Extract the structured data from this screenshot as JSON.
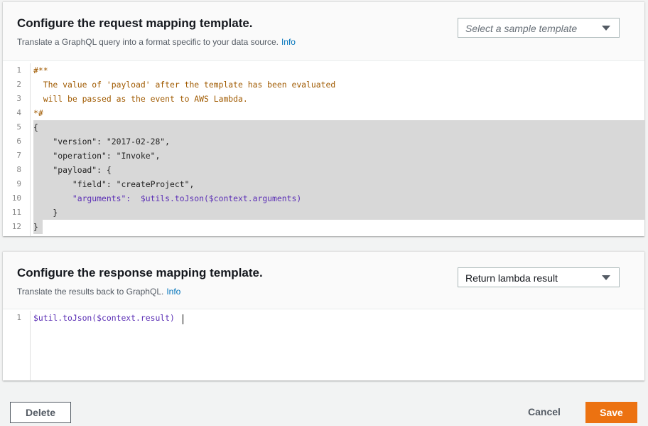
{
  "request": {
    "title": "Configure the request mapping template.",
    "subtitle": "Translate a GraphQL query into a format specific to your data source.",
    "info": "Info",
    "select_placeholder": "Select a sample template",
    "lines": [
      {
        "n": "1",
        "text": "#**"
      },
      {
        "n": "2",
        "text": "  The value of 'payload' after the template has been evaluated"
      },
      {
        "n": "3",
        "text": "  will be passed as the event to AWS Lambda."
      },
      {
        "n": "4",
        "text": "*#"
      },
      {
        "n": "5",
        "text": "{"
      },
      {
        "n": "6",
        "text": "    \"version\": \"2017-02-28\","
      },
      {
        "n": "7",
        "text": "    \"operation\": \"Invoke\","
      },
      {
        "n": "8",
        "text": "    \"payload\": {"
      },
      {
        "n": "9",
        "text": "        \"field\": \"createProject\","
      },
      {
        "n": "10",
        "text": "        \"arguments\":  $utils.toJson($context.arguments)"
      },
      {
        "n": "11",
        "text": "    }"
      },
      {
        "n": "12",
        "text": "}"
      }
    ]
  },
  "response": {
    "title": "Configure the response mapping template.",
    "subtitle": "Translate the results back to GraphQL.",
    "info": "Info",
    "select_value": "Return lambda result",
    "lines": [
      {
        "n": "1",
        "text": "$util.toJson($context.result)"
      }
    ]
  },
  "footer": {
    "delete_label": "Delete",
    "cancel_label": "Cancel",
    "save_label": "Save"
  },
  "colors": {
    "accent": "#ec7211",
    "link": "#0073bb",
    "comment": "#a05a00",
    "variable": "#5b2fb5"
  }
}
